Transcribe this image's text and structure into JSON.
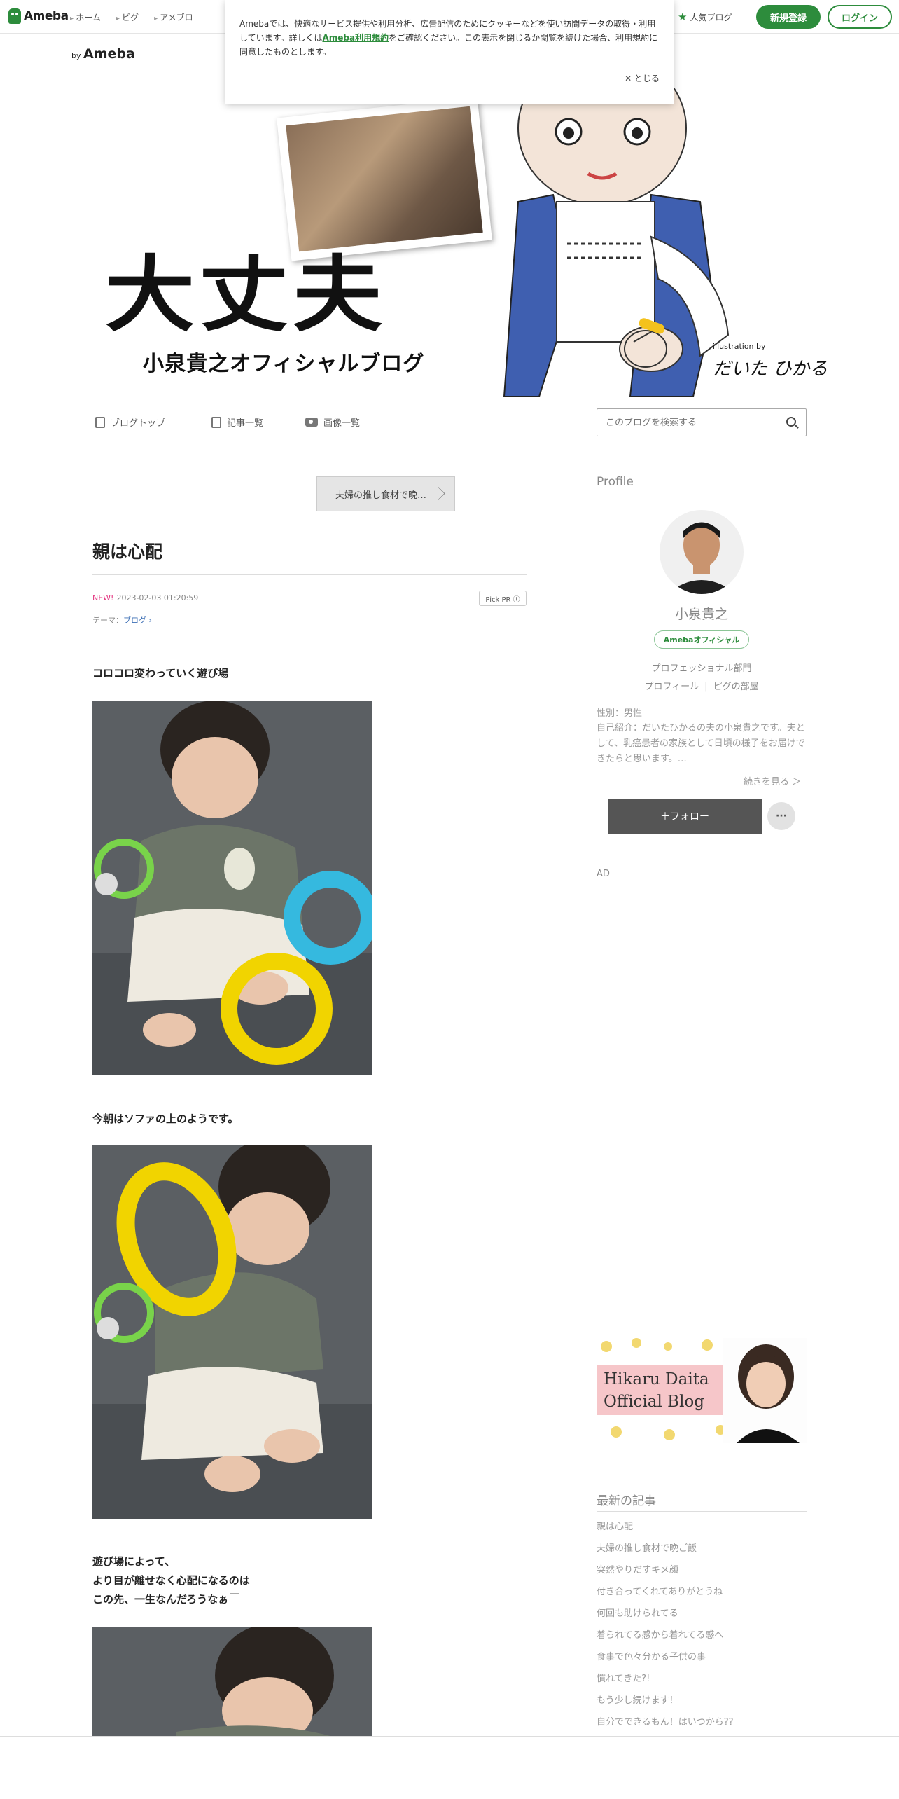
{
  "topbar": {
    "logo_text": "Ameba",
    "nav": [
      "ホーム",
      "ピグ",
      "アメブロ"
    ],
    "popular_label": "人気ブログ",
    "register_label": "新規登録",
    "login_label": "ログイン"
  },
  "cookie": {
    "text_before_link": "Amebaでは、快適なサービス提供や利用分析、広告配信のためにクッキーなどを使い訪問データの取得・利用しています。詳しくは",
    "link_label": "Ameba利用規約",
    "text_after_link": "をご確認ください。この表示を閉じるか閲覧を続けた場合、利用規約に同意したものとします。",
    "close_label": "✕ とじる"
  },
  "header": {
    "by_label": "by",
    "brand": "Ameba",
    "title": "大丈夫",
    "subtitle": "小泉貴之オフィシャルブログ",
    "illustration_credit": "illustration by",
    "signature": "だいた ひかる"
  },
  "blognav": {
    "top_label": "ブログトップ",
    "entries_label": "記事一覧",
    "images_label": "画像一覧",
    "search_placeholder": "このブログを検索する"
  },
  "article": {
    "pick_label": "夫婦の推し食材で晩…",
    "title": "親は心配",
    "new_label": "NEW!",
    "datetime": "2023-02-03 01:20:59",
    "pickpr_label": "Pick PR ⓘ",
    "theme_prefix": "テーマ：",
    "theme_link": "ブログ ›",
    "para1": "コロコロ変わっていく遊び場",
    "para2": "今朝はソファの上のようです。",
    "para3_line1": "遊び場によって、",
    "para3_line2": "より目が離せなく心配になるのは",
    "para3_line3": "この先、一生なんだろうなぁ"
  },
  "sidebar": {
    "profile_heading": "Profile",
    "name": "小泉貴之",
    "official_badge": "Amebaオフィシャル",
    "department": "プロフェッショナル部門",
    "link_profile": "プロフィール",
    "link_pig": "ピグの部屋",
    "sex": "性別：男性",
    "bio": "自己紹介：だいたひかるの夫の小泉貴之です。夫として、乳癌患者の家族として日頃の様子をお届けできたらと思います。…",
    "more_label": "続きを見る ＞",
    "follow_label": "＋フォロー",
    "more_menu": "···",
    "ad_label": "AD",
    "banner_line1": "Hikaru Daita",
    "banner_line2": "Official Blog",
    "latest_heading": "最新の記事",
    "latest": [
      "親は心配",
      "夫婦の推し食材で晩ご飯",
      "突然やりだすキメ顔",
      "付き合ってくれてありがとうね",
      "何回も助けられてる",
      "着られてる感から着れてる感へ",
      "食事で色々分かる子供の事",
      "慣れてきた?!",
      "もう少し続けます！",
      "自分でできるもん！はいつから??"
    ]
  },
  "colors": {
    "brand_green": "#2d8c3c",
    "new_pink": "#e3347f",
    "link_blue": "#3d6fb5",
    "follow_gray": "#555555"
  }
}
